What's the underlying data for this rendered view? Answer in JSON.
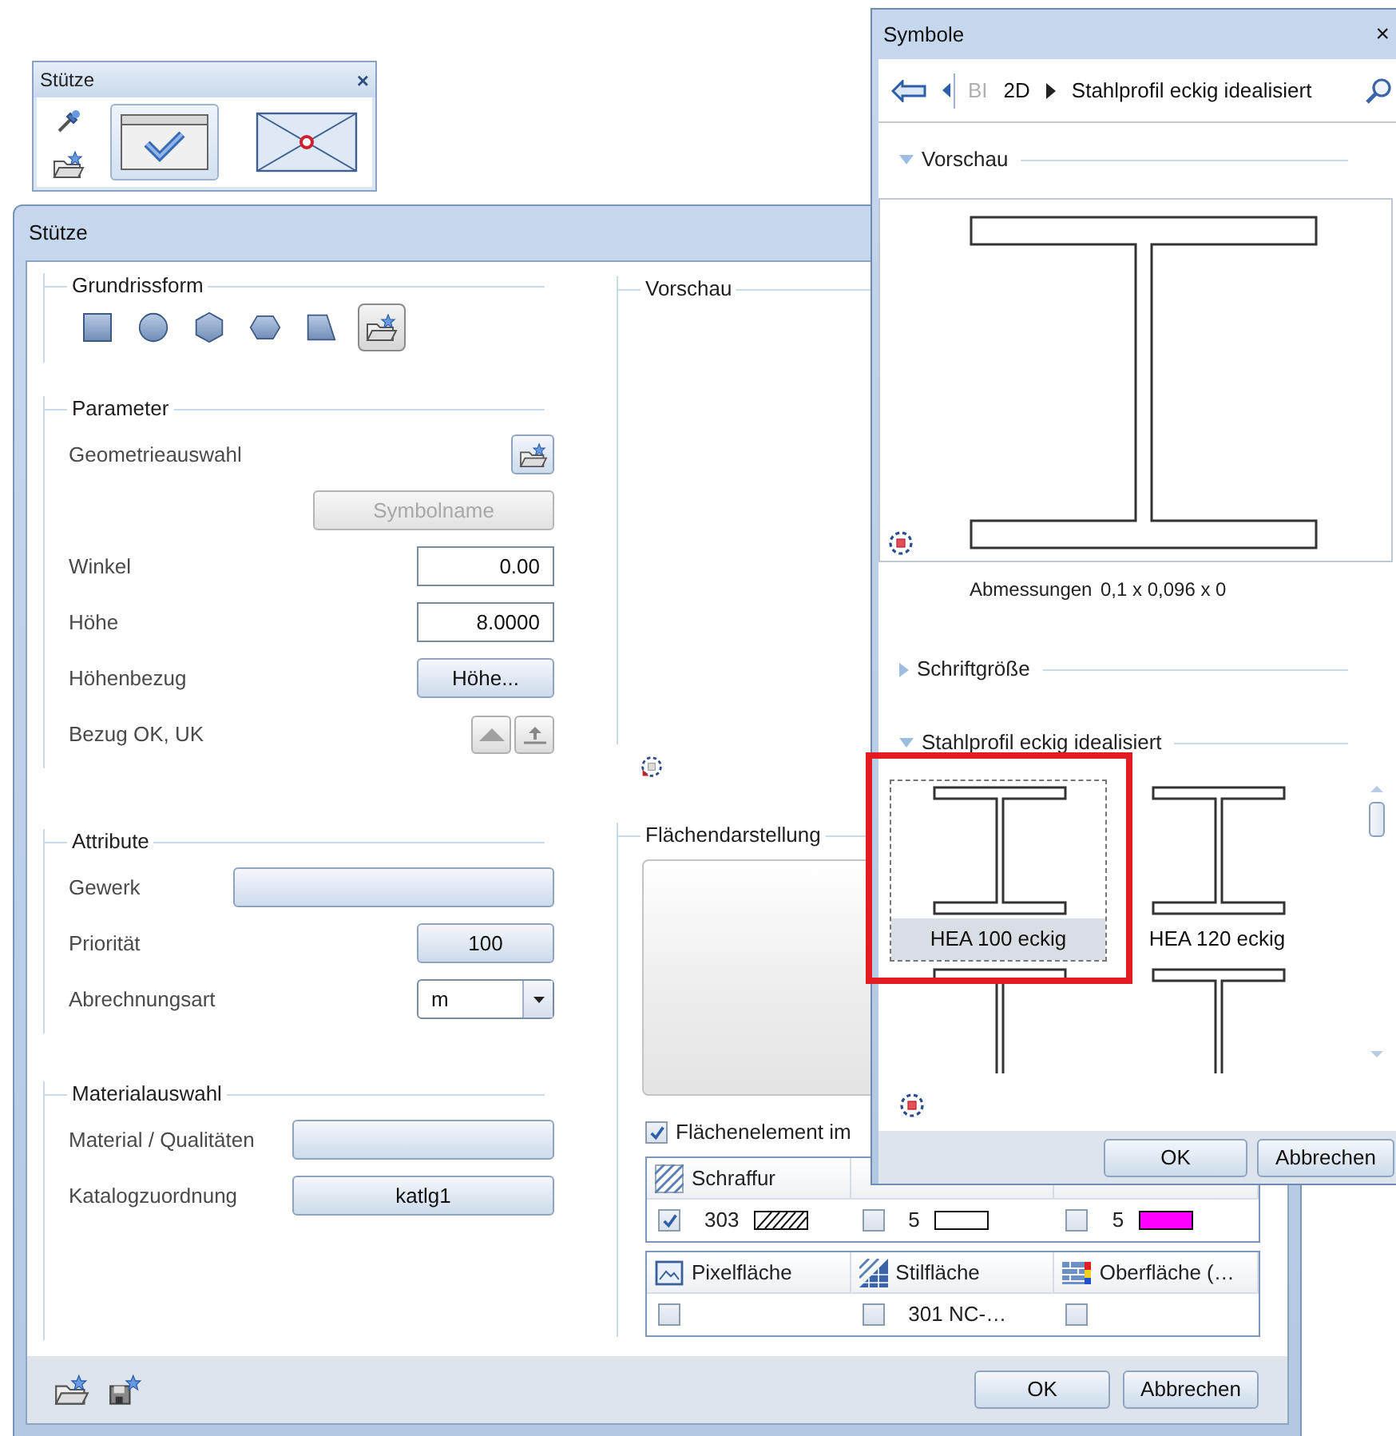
{
  "palette": {
    "title": "Stütze",
    "close": "×",
    "modes": [
      {
        "kind": "check",
        "selected": true
      },
      {
        "kind": "envelope",
        "selected": false
      }
    ]
  },
  "dialog": {
    "title": "Stütze",
    "shapes": {
      "label": "Grundrissform",
      "items": [
        {
          "kind": "square",
          "selected": false
        },
        {
          "kind": "circle",
          "selected": false
        },
        {
          "kind": "hexagon",
          "selected": false
        },
        {
          "kind": "hexagon_flat",
          "selected": false
        },
        {
          "kind": "trapezoid",
          "selected": false
        },
        {
          "kind": "folder",
          "selected": true
        }
      ]
    },
    "groups": [
      {
        "label": "Parameter",
        "rows": [
          {
            "kind": "icon_button",
            "label": "Geometrieauswahl",
            "disabled": false
          },
          {
            "kind": "wide_button",
            "value": "Symbolname",
            "disabled": true
          },
          {
            "kind": "input",
            "label": "Winkel",
            "value": "0.00",
            "disabled": false
          },
          {
            "kind": "input",
            "label": "Höhe",
            "value": "8.0000",
            "disabled": false
          },
          {
            "kind": "button",
            "label": "Höhenbezug",
            "value": "Höhe...",
            "disabled": false
          },
          {
            "kind": "updown",
            "label": "Bezug OK, UK",
            "disabled": false
          }
        ]
      },
      {
        "label": "Attribute",
        "rows": [
          {
            "kind": "wide_button",
            "label": "Gewerk",
            "disabled": false
          },
          {
            "kind": "button",
            "label": "Priorität",
            "value": "100",
            "disabled": false
          },
          {
            "kind": "dropdown",
            "label": "Abrechnungsart",
            "value": "m",
            "disabled": false
          }
        ]
      },
      {
        "label": "Materialauswahl",
        "rows": [
          {
            "kind": "wide_button",
            "label": "Material / Qualitäten",
            "disabled": false
          },
          {
            "kind": "wide_button",
            "label": "Katalogzuordnung",
            "value": "katlg1",
            "disabled": false
          }
        ]
      }
    ],
    "preview_label": "Vorschau",
    "surface": {
      "label": "Flächendarstellung",
      "checkbox": {
        "label": "Flächenelement im",
        "checked": true
      },
      "tables": [
        {
          "headers": [
            {
              "kind": "hatch",
              "label": "Schraffur"
            }
          ],
          "cells": [
            {
              "checked": true,
              "value": "303",
              "swatch": {
                "kind": "hatch"
              }
            },
            {
              "checked": false,
              "value": "5",
              "swatch": {
                "kind": "color",
                "color": "#ffffff"
              }
            },
            {
              "checked": false,
              "value": "5",
              "swatch": {
                "kind": "color",
                "color": "#ff00ff"
              }
            }
          ]
        },
        {
          "headers": [
            {
              "kind": "pixel",
              "label": "Pixelfläche"
            },
            {
              "kind": "style",
              "label": "Stilfläche"
            },
            {
              "kind": "surface",
              "label": "Oberfläche (…"
            }
          ],
          "cells": [
            {
              "checked": false
            },
            {
              "checked": false,
              "value": "301 NC-…"
            },
            {
              "checked": false
            }
          ]
        }
      ]
    },
    "buttons": [
      "OK",
      "Abbrechen"
    ]
  },
  "symbols": {
    "title": "Symbole",
    "close": "×",
    "path": [
      {
        "text": "BI",
        "disabled": true
      },
      {
        "text": "2D",
        "disabled": false
      },
      {
        "text": "Stahlprofil eckig idealisiert",
        "disabled": false
      }
    ],
    "preview": {
      "label": "Vorschau",
      "expanded": true,
      "dimensions_label": "Abmessungen",
      "dimensions": "0,1 x 0,096 x 0"
    },
    "font_size": {
      "label": "Schriftgröße",
      "expanded": false
    },
    "gallery": {
      "label": "Stahlprofil eckig idealisiert",
      "expanded": true,
      "items": [
        {
          "label": "HEA 100 eckig",
          "selected": true,
          "highlighted": true
        },
        {
          "label": "HEA 120 eckig",
          "selected": false,
          "highlighted": false
        },
        {
          "selected": false,
          "highlighted": false
        },
        {
          "selected": false,
          "highlighted": false
        }
      ]
    },
    "buttons": [
      "OK",
      "Abbrechen"
    ]
  }
}
